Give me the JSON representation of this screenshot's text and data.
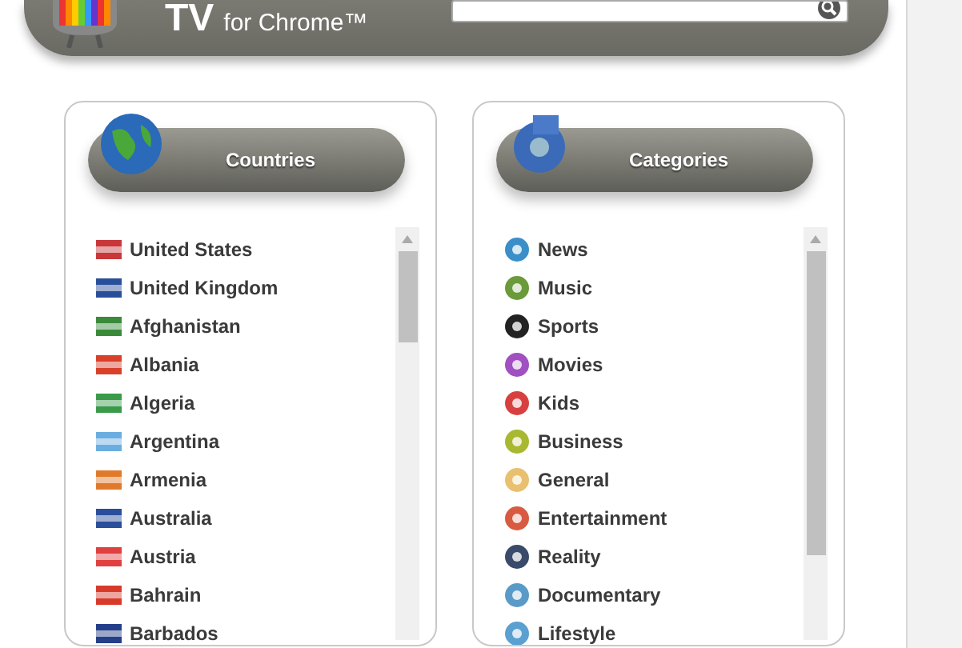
{
  "header": {
    "logo_text": "TV",
    "logo_subtext": "for Chrome™"
  },
  "countries": {
    "title": "Countries",
    "items": [
      {
        "label": "United States",
        "color": "#c8383a"
      },
      {
        "label": "United Kingdom",
        "color": "#2a4f9a"
      },
      {
        "label": "Afghanistan",
        "color": "#3a8a3a"
      },
      {
        "label": "Albania",
        "color": "#d8402a"
      },
      {
        "label": "Algeria",
        "color": "#3a9a4a"
      },
      {
        "label": "Argentina",
        "color": "#6aaee0"
      },
      {
        "label": "Armenia",
        "color": "#e07a2a"
      },
      {
        "label": "Australia",
        "color": "#2a4f9a"
      },
      {
        "label": "Austria",
        "color": "#e04040"
      },
      {
        "label": "Bahrain",
        "color": "#d83a2a"
      },
      {
        "label": "Barbados",
        "color": "#243f8a"
      }
    ]
  },
  "categories": {
    "title": "Categories",
    "items": [
      {
        "label": "News",
        "color": "#3a8fc8"
      },
      {
        "label": "Music",
        "color": "#6a9a3a"
      },
      {
        "label": "Sports",
        "color": "#222222"
      },
      {
        "label": "Movies",
        "color": "#a050c0"
      },
      {
        "label": "Kids",
        "color": "#d84040"
      },
      {
        "label": "Business",
        "color": "#a8b830"
      },
      {
        "label": "General",
        "color": "#e8c070"
      },
      {
        "label": "Entertainment",
        "color": "#d85a40"
      },
      {
        "label": "Reality",
        "color": "#3a4a6a"
      },
      {
        "label": "Documentary",
        "color": "#5a9ac8"
      },
      {
        "label": "Lifestyle",
        "color": "#5aa0d0"
      }
    ]
  }
}
